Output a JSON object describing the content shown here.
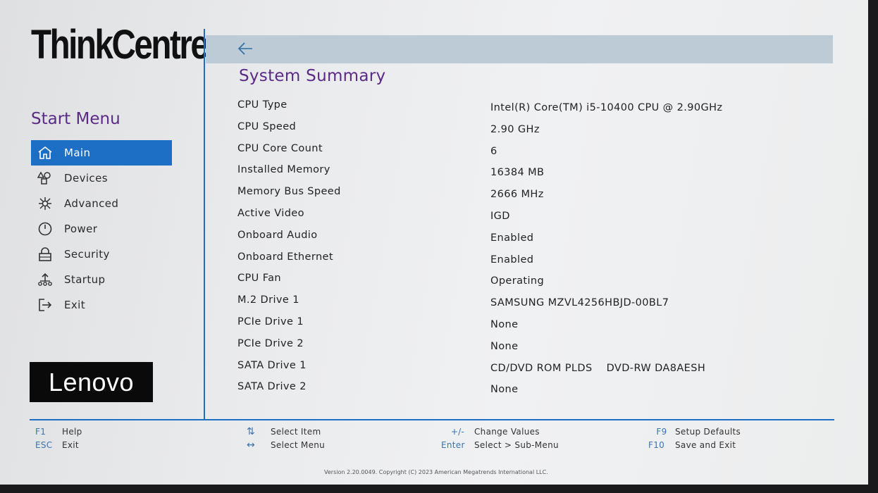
{
  "brand": {
    "name": "ThinkCentre",
    "vendor_logo": "Lenovo"
  },
  "sidebar": {
    "title": "Start Menu",
    "items": [
      {
        "label": "Main",
        "icon": "home-icon",
        "active": true
      },
      {
        "label": "Devices",
        "icon": "devices-icon",
        "active": false
      },
      {
        "label": "Advanced",
        "icon": "advanced-icon",
        "active": false
      },
      {
        "label": "Power",
        "icon": "power-icon",
        "active": false
      },
      {
        "label": "Security",
        "icon": "lock-icon",
        "active": false
      },
      {
        "label": "Startup",
        "icon": "startup-icon",
        "active": false
      },
      {
        "label": "Exit",
        "icon": "exit-icon",
        "active": false
      }
    ]
  },
  "main": {
    "back_icon": "arrow-left-icon",
    "title": "System Summary",
    "rows": [
      {
        "label": "CPU Type",
        "value": "Intel(R) Core(TM) i5-10400 CPU @ 2.90GHz"
      },
      {
        "label": "CPU Speed",
        "value": "2.90 GHz"
      },
      {
        "label": "CPU Core Count",
        "value": "6"
      },
      {
        "label": "Installed Memory",
        "value": "16384 MB"
      },
      {
        "label": "Memory Bus Speed",
        "value": "2666 MHz"
      },
      {
        "label": "Active Video",
        "value": "IGD"
      },
      {
        "label": "Onboard Audio",
        "value": "Enabled"
      },
      {
        "label": "Onboard Ethernet",
        "value": "Enabled"
      },
      {
        "label": "CPU Fan",
        "value": "Operating"
      },
      {
        "label": "M.2 Drive 1",
        "value": "SAMSUNG MZVL4256HBJD-00BL7"
      },
      {
        "label": "PCIe Drive 1",
        "value": "None"
      },
      {
        "label": "PCIe Drive 2",
        "value": "None"
      },
      {
        "label": "SATA Drive 1",
        "value": "CD/DVD ROM PLDS    DVD-RW DA8AESH"
      },
      {
        "label": "SATA Drive 2",
        "value": "None"
      }
    ]
  },
  "footer": {
    "keys": [
      {
        "key": "F1",
        "action": "Help"
      },
      {
        "key": "ESC",
        "action": "Exit"
      },
      {
        "key": "⇅",
        "action": "Select Item"
      },
      {
        "key": "↔",
        "action": "Select Menu"
      },
      {
        "key": "+/-",
        "action": "Change Values"
      },
      {
        "key": "Enter",
        "action": "Select > Sub-Menu"
      },
      {
        "key": "F9",
        "action": "Setup Defaults"
      },
      {
        "key": "F10",
        "action": "Save and Exit"
      }
    ],
    "version": "Version 2.20.0049. Copyright (C) 2023 American Megatrends International LLC."
  },
  "colors": {
    "accent": "#1c6fc4",
    "title": "#5b2a86",
    "brand_dot": "#d2101e",
    "topbar": "#bccbd6"
  }
}
